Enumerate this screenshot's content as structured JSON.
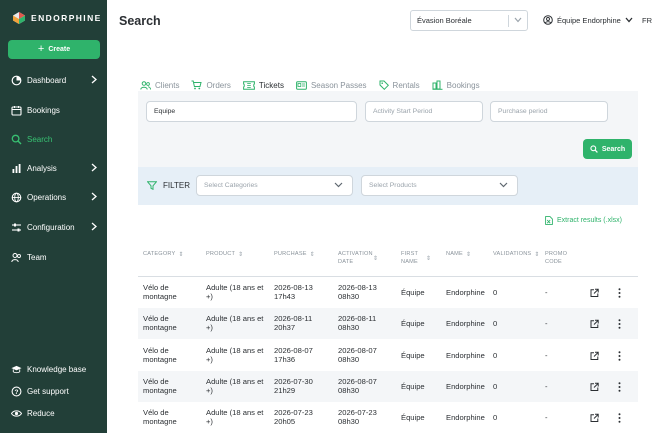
{
  "brand": {
    "name": "ENDORPHINE"
  },
  "sidebar": {
    "create_label": "Create",
    "items": [
      {
        "label": "Dashboard",
        "icon": "dashboard-icon",
        "has_chevron": true
      },
      {
        "label": "Bookings",
        "icon": "calendar-icon",
        "has_chevron": false
      },
      {
        "label": "Search",
        "icon": "search-icon",
        "has_chevron": false,
        "active": true
      },
      {
        "label": "Analysis",
        "icon": "bar-chart-icon",
        "has_chevron": true
      },
      {
        "label": "Operations",
        "icon": "globe-icon",
        "has_chevron": true
      },
      {
        "label": "Configuration",
        "icon": "sliders-icon",
        "has_chevron": true
      },
      {
        "label": "Team",
        "icon": "users-icon",
        "has_chevron": false
      }
    ],
    "bottom_items": [
      {
        "label": "Knowledge base",
        "icon": "graduation-cap-icon"
      },
      {
        "label": "Get support",
        "icon": "help-icon"
      },
      {
        "label": "Reduce",
        "icon": "eye-icon"
      }
    ]
  },
  "header": {
    "title": "Search",
    "org_selected": "Évasion Boréale",
    "user_label": "Équipe Endorphine",
    "lang": "FR"
  },
  "tabs": [
    {
      "label": "Clients",
      "icon": "users-icon"
    },
    {
      "label": "Orders",
      "icon": "cart-icon"
    },
    {
      "label": "Tickets",
      "icon": "ticket-icon",
      "active": true
    },
    {
      "label": "Season Passes",
      "icon": "pass-icon"
    },
    {
      "label": "Rentals",
      "icon": "tag-icon"
    },
    {
      "label": "Bookings",
      "icon": "bookings-icon"
    }
  ],
  "search": {
    "query_value": "Equipe",
    "activity_placeholder": "Activity Start Period",
    "purchase_placeholder": "Purchase period",
    "button_label": "Search"
  },
  "filter": {
    "label": "FILTER",
    "categories_placeholder": "Select Categories",
    "products_placeholder": "Select Products"
  },
  "extract_label": "Extract results (.xlsx)",
  "table": {
    "headers": {
      "category": "CATEGORY",
      "product": "PRODUCT",
      "purchase": "PURCHASE",
      "activation_date": "ACTIVATION DATE",
      "first_name": "FIRST NAME",
      "name": "NAME",
      "validations": "VALIDATIONS",
      "promo_code": "PROMO CODE"
    },
    "rows": [
      {
        "category": "Vélo de montagne",
        "product": "Adulte (18 ans et +)",
        "purchase_date": "2026-08-13",
        "purchase_time": "17h43",
        "activation_date": "2026-08-13",
        "activation_time": "08h30",
        "first_name": "Équipe",
        "name": "Endorphine",
        "validations": "0",
        "promo": "-"
      },
      {
        "category": "Vélo de montagne",
        "product": "Adulte (18 ans et +)",
        "purchase_date": "2026-08-11",
        "purchase_time": "20h37",
        "activation_date": "2026-08-11",
        "activation_time": "08h30",
        "first_name": "Équipe",
        "name": "Endorphine",
        "validations": "0",
        "promo": "-"
      },
      {
        "category": "Vélo de montagne",
        "product": "Adulte (18 ans et +)",
        "purchase_date": "2026-08-07",
        "purchase_time": "17h36",
        "activation_date": "2026-08-07",
        "activation_time": "08h30",
        "first_name": "Équipe",
        "name": "Endorphine",
        "validations": "0",
        "promo": "-"
      },
      {
        "category": "Vélo de montagne",
        "product": "Adulte (18 ans et +)",
        "purchase_date": "2026-07-30",
        "purchase_time": "21h29",
        "activation_date": "2026-08-07",
        "activation_time": "08h30",
        "first_name": "Équipe",
        "name": "Endorphine",
        "validations": "0",
        "promo": "-"
      },
      {
        "category": "Vélo de montagne",
        "product": "Adulte (18 ans et +)",
        "purchase_date": "2026-07-23",
        "purchase_time": "20h05",
        "activation_date": "2026-07-23",
        "activation_time": "08h30",
        "first_name": "Équipe",
        "name": "Endorphine",
        "validations": "0",
        "promo": "-"
      }
    ]
  },
  "colors": {
    "sidebar_bg": "#223f38",
    "accent": "#2fb36b",
    "active_nav": "#38c172",
    "filter_bg": "#e6eff7"
  }
}
